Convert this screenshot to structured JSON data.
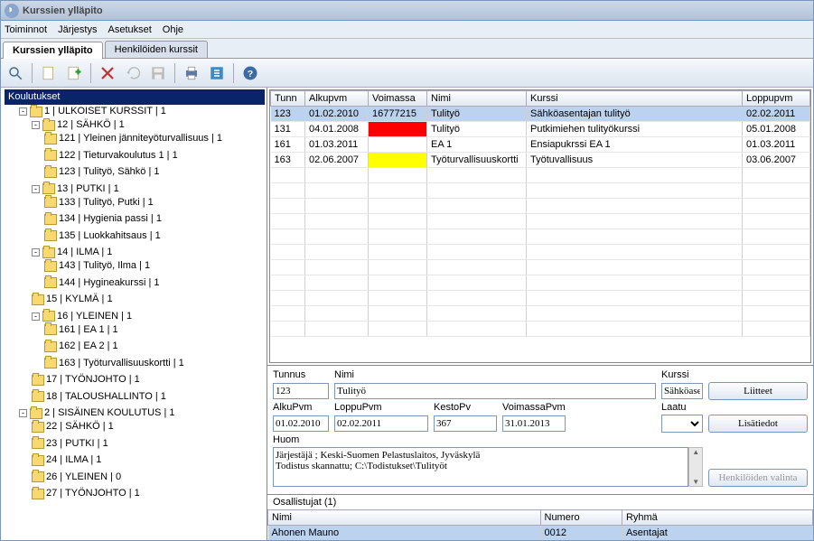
{
  "window_title": "Kurssien ylläpito",
  "menu": [
    "Toiminnot",
    "Järjestys",
    "Asetukset",
    "Ohje"
  ],
  "tabs": [
    {
      "label": "Kurssien ylläpito",
      "active": true
    },
    {
      "label": "Henkilöiden kurssit",
      "active": false
    }
  ],
  "tree": {
    "root": "Koulutukset",
    "items": [
      {
        "l": 0,
        "exp": "-",
        "label": "1 | ULKOISET KURSSIT | 1"
      },
      {
        "l": 1,
        "exp": "-",
        "label": "12 | SÄHKÖ | 1"
      },
      {
        "l": 2,
        "exp": "",
        "label": "121 | Yleinen jänniteyöturvallisuus | 1"
      },
      {
        "l": 2,
        "exp": "",
        "label": "122 | Tieturvakoulutus 1 | 1"
      },
      {
        "l": 2,
        "exp": "",
        "label": "123 | Tulityö, Sähkö | 1"
      },
      {
        "l": 1,
        "exp": "-",
        "label": "13 | PUTKI | 1"
      },
      {
        "l": 2,
        "exp": "",
        "label": "133 | Tulityö, Putki | 1"
      },
      {
        "l": 2,
        "exp": "",
        "label": "134 | Hygienia passi | 1"
      },
      {
        "l": 2,
        "exp": "",
        "label": "135 | Luokkahitsaus | 1"
      },
      {
        "l": 1,
        "exp": "-",
        "label": "14 | ILMA | 1"
      },
      {
        "l": 2,
        "exp": "",
        "label": "143 | Tulityö, Ilma | 1"
      },
      {
        "l": 2,
        "exp": "",
        "label": "144 | Hygineakurssi | 1"
      },
      {
        "l": 1,
        "exp": "",
        "label": "15 | KYLMÄ | 1"
      },
      {
        "l": 1,
        "exp": "-",
        "label": "16 | YLEINEN | 1"
      },
      {
        "l": 2,
        "exp": "",
        "label": "161 | EA 1 | 1"
      },
      {
        "l": 2,
        "exp": "",
        "label": "162 | EA 2 | 1"
      },
      {
        "l": 2,
        "exp": "",
        "label": "163 | Työturvallisuuskortti | 1"
      },
      {
        "l": 1,
        "exp": "",
        "label": "17 | TYÖNJOHTO | 1"
      },
      {
        "l": 1,
        "exp": "",
        "label": "18 | TALOUSHALLINTO | 1"
      },
      {
        "l": 0,
        "exp": "-",
        "label": "2 | SISÄINEN KOULUTUS | 1"
      },
      {
        "l": 1,
        "exp": "",
        "label": "22 | SÄHKÖ | 1"
      },
      {
        "l": 1,
        "exp": "",
        "label": "23 | PUTKI | 1"
      },
      {
        "l": 1,
        "exp": "",
        "label": "24 | ILMA | 1"
      },
      {
        "l": 1,
        "exp": "",
        "label": "26 | YLEINEN | 0"
      },
      {
        "l": 1,
        "exp": "",
        "label": "27 | TYÖNJOHTO | 1"
      }
    ]
  },
  "grid": {
    "headers": [
      "Tunn",
      "Alkupvm",
      "Voimassa",
      "Nimi",
      "Kurssi",
      "Loppupvm"
    ],
    "rows": [
      {
        "sel": true,
        "tunn": "123",
        "alku": "01.02.2010",
        "voimassa": "16777215",
        "vo_class": "",
        "nimi": "Tulityö",
        "kurssi": "Sähköasentajan tulityö",
        "loppu": "02.02.2011"
      },
      {
        "sel": false,
        "tunn": "131",
        "alku": "04.01.2008",
        "voimassa": "",
        "vo_class": "vo-red",
        "nimi": "Tulityö",
        "kurssi": "Putkimiehen tulityökurssi",
        "loppu": "05.01.2008"
      },
      {
        "sel": false,
        "tunn": "161",
        "alku": "01.03.2011",
        "voimassa": "",
        "vo_class": "",
        "nimi": "EA 1",
        "kurssi": "Ensiapukrssi EA 1",
        "loppu": "01.03.2011"
      },
      {
        "sel": false,
        "tunn": "163",
        "alku": "02.06.2007",
        "voimassa": "",
        "vo_class": "vo-yellow",
        "nimi": "Työturvallisuuskortti",
        "kurssi": "Työtuvallisuus",
        "loppu": "03.06.2007"
      }
    ]
  },
  "form": {
    "labels": {
      "tunnus": "Tunnus",
      "nimi": "Nimi",
      "kurssi": "Kurssi",
      "alku": "AlkuPvm",
      "loppu": "LoppuPvm",
      "kesto": "KestoPv",
      "voimassa": "VoimassaPvm",
      "laatu": "Laatu",
      "huom": "Huom"
    },
    "tunnus": "123",
    "nimi": "Tulityö",
    "kurssi": "Sähköasentajan tulityö",
    "alku": "01.02.2010",
    "loppu": "02.02.2011",
    "kesto": "367",
    "voimassa": "31.01.2013",
    "laatu": "",
    "huom": "Järjestäjä ; Keski-Suomen Pelastuslaitos, Jyväskylä\nTodistus skannattu; C:\\Todistukset\\Tulityöt"
  },
  "buttons": {
    "liitteet": "Liitteet",
    "lisatiedot": "Lisätiedot",
    "henkvalinta": "Henkilöiden valinta"
  },
  "participants": {
    "title": "Osallistujat (1)",
    "headers": [
      "Nimi",
      "Numero",
      "Ryhmä"
    ],
    "rows": [
      {
        "nimi": "Ahonen Mauno",
        "numero": "0012",
        "ryhma": "Asentajat"
      }
    ]
  }
}
